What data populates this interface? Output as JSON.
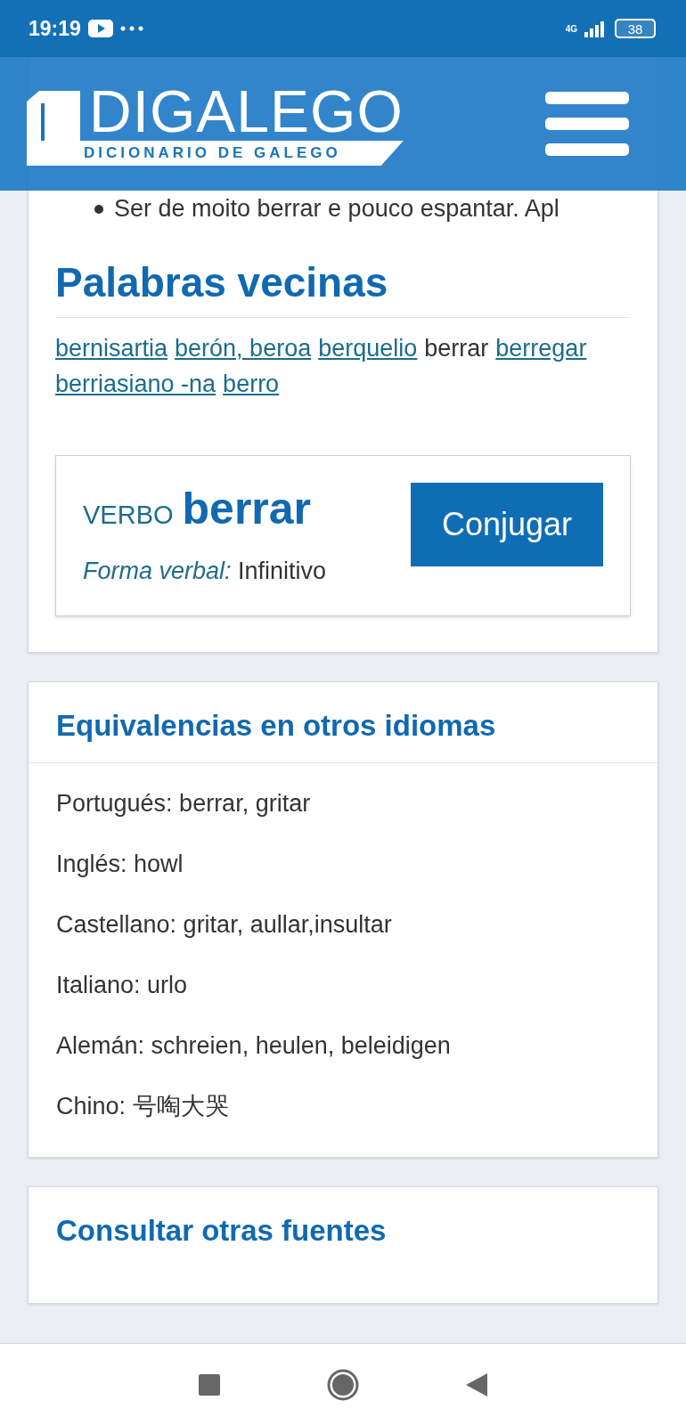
{
  "status_bar": {
    "time": "19:19",
    "network": "4G",
    "battery": "38"
  },
  "header": {
    "logo_title": "DIGALEGO",
    "logo_subtitle": "DICIONARIO DE GALEGO"
  },
  "expressions": {
    "items": [
      "Ser de moito berrar e pouco espantar. Apl"
    ]
  },
  "neighbors": {
    "title": "Palabras vecinas",
    "words": [
      {
        "text": "bernisartia",
        "kind": "link"
      },
      {
        "text": "berón, beroa",
        "kind": "link"
      },
      {
        "text": "berquelio",
        "kind": "link"
      },
      {
        "text": "berrar",
        "kind": "current"
      },
      {
        "text": "berregar",
        "kind": "link"
      },
      {
        "text": "berriasiano -na",
        "kind": "link"
      },
      {
        "text": "berro",
        "kind": "link"
      }
    ]
  },
  "verb_card": {
    "category": "VERBO",
    "word": "berrar",
    "button": "Conjugar",
    "form_label": "Forma verbal:",
    "form_value": "Infinitivo"
  },
  "equivalences": {
    "title": "Equivalencias en otros idiomas",
    "items": [
      {
        "language": "Portugués:",
        "value": "berrar, gritar"
      },
      {
        "language": "Inglés:",
        "value": "howl"
      },
      {
        "language": "Castellano:",
        "value": "gritar, aullar,insultar"
      },
      {
        "language": "Italiano:",
        "value": "urlo"
      },
      {
        "language": "Alemán:",
        "value": "schreien, heulen, beleidigen"
      },
      {
        "language": "Chino:",
        "value": "号啕大哭"
      }
    ]
  },
  "other_sources": {
    "title": "Consultar otras fuentes"
  }
}
